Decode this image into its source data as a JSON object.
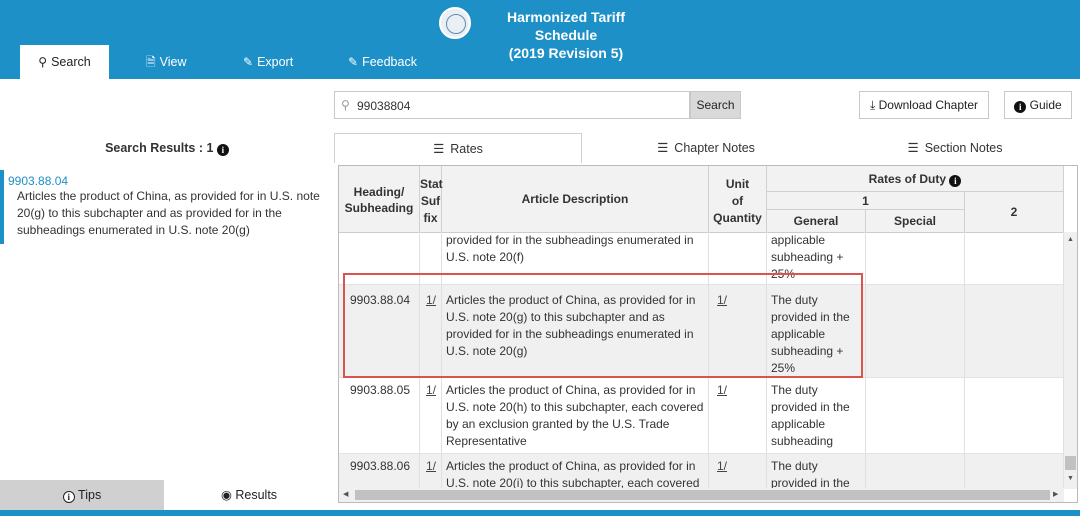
{
  "app": {
    "title_line1": "Harmonized Tariff Schedule",
    "title_line2": "(2019 Revision 5)"
  },
  "nav": {
    "tabs": [
      {
        "label": "Search",
        "icon": "search-icon"
      },
      {
        "label": "View",
        "icon": "document-icon"
      },
      {
        "label": "Export",
        "icon": "export-icon"
      },
      {
        "label": "Feedback",
        "icon": "feedback-icon"
      }
    ]
  },
  "search": {
    "value": "99038804",
    "button_label": "Search"
  },
  "toolbar": {
    "download_label": "Download Chapter",
    "guide_label": "Guide"
  },
  "results": {
    "header": "Search Results : 1",
    "items": [
      {
        "code": "9903.88.04",
        "description": "Articles the product of China, as provided for in U.S. note 20(g) to this subchapter and as provided for in the subheadings enumerated in U.S. note 20(g)"
      }
    ]
  },
  "bottom_tabs": {
    "tips": "Tips",
    "results": "Results"
  },
  "view_tabs": {
    "rates": "Rates",
    "chapter_notes": "Chapter Notes",
    "section_notes": "Section Notes"
  },
  "table": {
    "headers": {
      "heading_line1": "Heading/",
      "heading_line2": "Subheading",
      "stat_line1": "Stat",
      "stat_line2": "Suf",
      "stat_line3": "fix",
      "article": "Article Description",
      "unit_line1": "Unit",
      "unit_line2": "of",
      "unit_line3": "Quantity",
      "rates": "Rates of Duty",
      "col1": "1",
      "general": "General",
      "special": "Special",
      "col2": "2"
    },
    "rows": [
      {
        "heading": "",
        "stat": "",
        "description": "provided for in the subheadings enumerated in U.S. note 20(f)",
        "unit": "",
        "general": "applicable subheading + 25%",
        "special": "",
        "col2": ""
      },
      {
        "heading": "9903.88.04",
        "stat": "1/",
        "description": "Articles the product of China, as provided for in U.S. note 20(g) to this subchapter and as provided for in the subheadings enumerated in U.S. note 20(g)",
        "unit": "1/",
        "general": "The duty provided in the applicable subheading + 25%",
        "special": "",
        "col2": ""
      },
      {
        "heading": "9903.88.05",
        "stat": "1/",
        "description": "Articles the product of China, as provided for in U.S. note 20(h) to this subchapter, each covered by an exclusion granted by the U.S. Trade Representative",
        "unit": "1/",
        "general": "The duty provided in the applicable subheading",
        "special": "",
        "col2": ""
      },
      {
        "heading": "9903.88.06",
        "stat": "1/",
        "description": "Articles the product of China, as provided for in U.S. note 20(i) to this subchapter, each covered",
        "unit": "1/",
        "general": "The duty provided in the",
        "special": "",
        "col2": ""
      }
    ]
  },
  "colors": {
    "brand": "#1e90c8",
    "highlight": "#d9534f"
  }
}
